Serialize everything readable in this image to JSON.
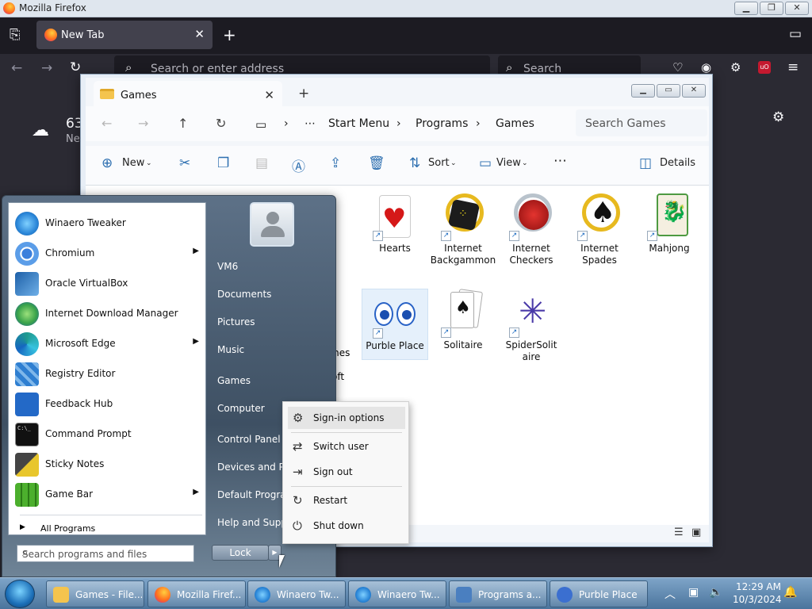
{
  "firefox": {
    "window_title": "Mozilla Firefox",
    "tab_label": "New Tab",
    "address_placeholder": "Search or enter address",
    "search_placeholder": "Search",
    "weather_temp": "63",
    "weather_loc": "Ne"
  },
  "explorer": {
    "tab_label": "Games",
    "breadcrumb": [
      "Start Menu",
      "Programs",
      "Games"
    ],
    "search_placeholder": "Search Games",
    "commands": {
      "new": "New",
      "sort": "Sort",
      "view": "View",
      "details": "Details"
    },
    "items": [
      {
        "label": "Hearts"
      },
      {
        "label": "Internet Backgammon"
      },
      {
        "label": "Internet Checkers"
      },
      {
        "label": "Internet Spades"
      },
      {
        "label": "Mahjong"
      },
      {
        "label": "Purble Place"
      },
      {
        "label": "Solitaire"
      },
      {
        "label": "SpiderSolitaire"
      }
    ],
    "partial_labels": [
      "ll",
      "mes",
      "oft"
    ]
  },
  "start_menu": {
    "programs": [
      {
        "label": "Winaero Tweaker",
        "color": "#2a86d8",
        "arrow": false
      },
      {
        "label": "Chromium",
        "color": "#3b7fdc",
        "arrow": true
      },
      {
        "label": "Oracle VirtualBox",
        "color": "#1d5fa7",
        "arrow": false
      },
      {
        "label": "Internet Download Manager",
        "color": "#3aa34a",
        "arrow": false
      },
      {
        "label": "Microsoft Edge",
        "color": "#1e9a8e",
        "arrow": true
      },
      {
        "label": "Registry Editor",
        "color": "#2f7fd1",
        "arrow": false
      },
      {
        "label": "Feedback Hub",
        "color": "#2369c7",
        "arrow": false
      },
      {
        "label": "Command Prompt",
        "color": "#111111",
        "arrow": false
      },
      {
        "label": "Sticky Notes",
        "color": "#e8c62c",
        "arrow": false
      },
      {
        "label": "Game Bar",
        "color": "#4caf2d",
        "arrow": true
      }
    ],
    "all_programs": "All Programs",
    "search_placeholder": "Search programs and files",
    "right_items": [
      "VM6",
      "Documents",
      "Pictures",
      "Music",
      "Games",
      "Computer",
      "Control Panel",
      "Devices and Prin",
      "Default Program",
      "Help and Suppo"
    ],
    "lock_label": "Lock"
  },
  "context_menu": [
    "Sign-in options",
    "Switch user",
    "Sign out",
    "Restart",
    "Shut down"
  ],
  "taskbar": {
    "buttons": [
      {
        "label": "Games - File...",
        "color": "#f4c44e"
      },
      {
        "label": "Mozilla Firef...",
        "color": "#ff6f1e"
      },
      {
        "label": "Winaero Tw...",
        "color": "#2a86d8"
      },
      {
        "label": "Winaero Tw...",
        "color": "#2a86d8"
      },
      {
        "label": "Programs a...",
        "color": "#4a7fc0"
      },
      {
        "label": "Purble Place",
        "color": "#3b6fd0"
      }
    ],
    "time": "12:29 AM",
    "date": "10/3/2024"
  }
}
